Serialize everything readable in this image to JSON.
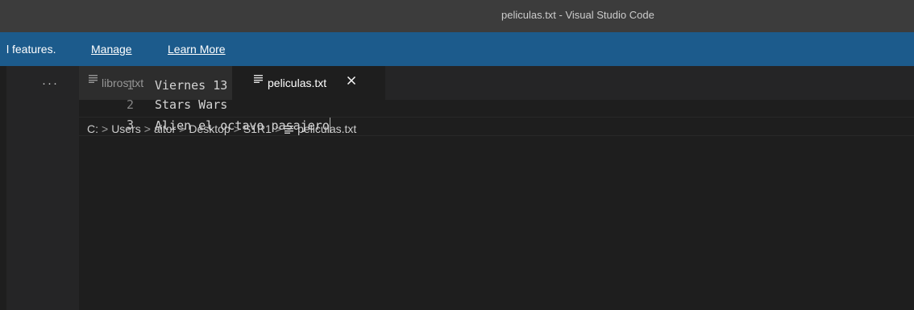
{
  "window": {
    "title": "peliculas.txt - Visual Studio Code"
  },
  "banner": {
    "message": "l features.",
    "manage_label": "Manage",
    "learn_more_label": "Learn More"
  },
  "sidebar": {
    "more_actions_label": "···"
  },
  "tabs": [
    {
      "label": "libros.txt",
      "icon": "text-file-icon",
      "active": false
    },
    {
      "label": "peliculas.txt",
      "icon": "text-file-icon",
      "active": true,
      "close_glyph": "close-icon"
    }
  ],
  "breadcrumb": {
    "items": [
      "C:",
      "Users",
      "aitor",
      "Desktop",
      "S1R1",
      "peliculas.txt"
    ],
    "separator": ">"
  },
  "editor": {
    "lines": [
      {
        "number": "1",
        "text": "Viernes 13"
      },
      {
        "number": "2",
        "text": "Stars Wars"
      },
      {
        "number": "3",
        "text": "Alien el octavo pasajero"
      }
    ],
    "current_line": 3
  },
  "colors": {
    "titlebar": "#3c3c3c",
    "banner": "#1c5b8c",
    "editor_bg": "#1e1e1e",
    "tabbar_bg": "#252526",
    "inactive_tab": "#2d2d2d"
  }
}
